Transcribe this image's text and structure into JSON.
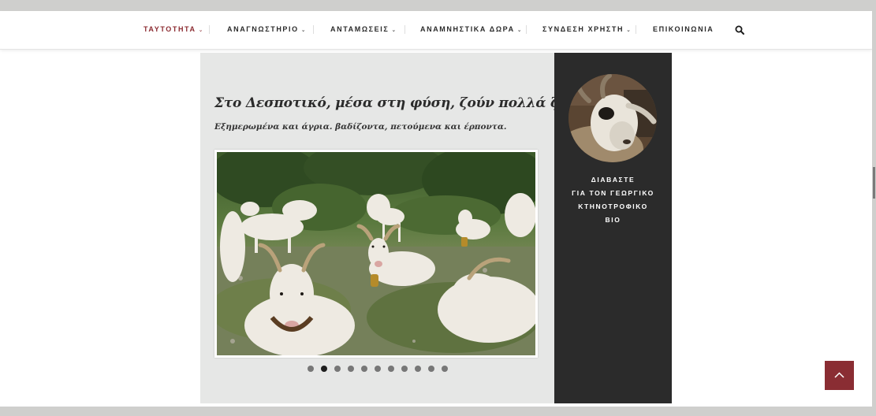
{
  "nav": {
    "items": [
      {
        "label": "ΤΑΥΤΟΤΗΤΑ",
        "has_dropdown": true,
        "active": true
      },
      {
        "label": "ΑΝΑΓΝΩΣΤΗΡΙΟ",
        "has_dropdown": true,
        "active": false
      },
      {
        "label": "ΑΝΤΑΜΩΣΕΙΣ",
        "has_dropdown": true,
        "active": false
      },
      {
        "label": "ΑΝΑΜΝΗΣΤΙΚΑ ΔΩΡΑ",
        "has_dropdown": true,
        "active": false
      },
      {
        "label": "ΣΥΝΔΕΣΗ ΧΡΗΣΤΗ",
        "has_dropdown": true,
        "active": false
      },
      {
        "label": "ΕΠΙΚΟΙΝΩΝΙΑ",
        "has_dropdown": false,
        "active": false
      }
    ],
    "search_icon": "search-icon",
    "active_color": "#8c2c32"
  },
  "main": {
    "headline": "Στο Δεσποτικό, μέσα στη φύση, ζούν πολλά ζώα.",
    "subline": "Εξημερωμένα και άγρια. βαδίζοντα, πετούμενα και έρποντα.",
    "slider": {
      "image": "goats-photo",
      "slide_count": 11,
      "active_index": 1
    }
  },
  "sidebar": {
    "avatar_image": "goat-portrait",
    "lines": [
      "ΔΙΑΒΑΣΤΕ",
      "ΓΙΑ ΤΟΝ ΓΕΩΡΓΙΚΟ",
      "ΚΤΗΝΟΤΡΟΦΙΚΟ",
      "ΒΙΟ"
    ],
    "background_color": "#2b2b2b"
  },
  "back_to_top": {
    "icon": "chevron-up-icon",
    "color": "#8a2d33"
  }
}
